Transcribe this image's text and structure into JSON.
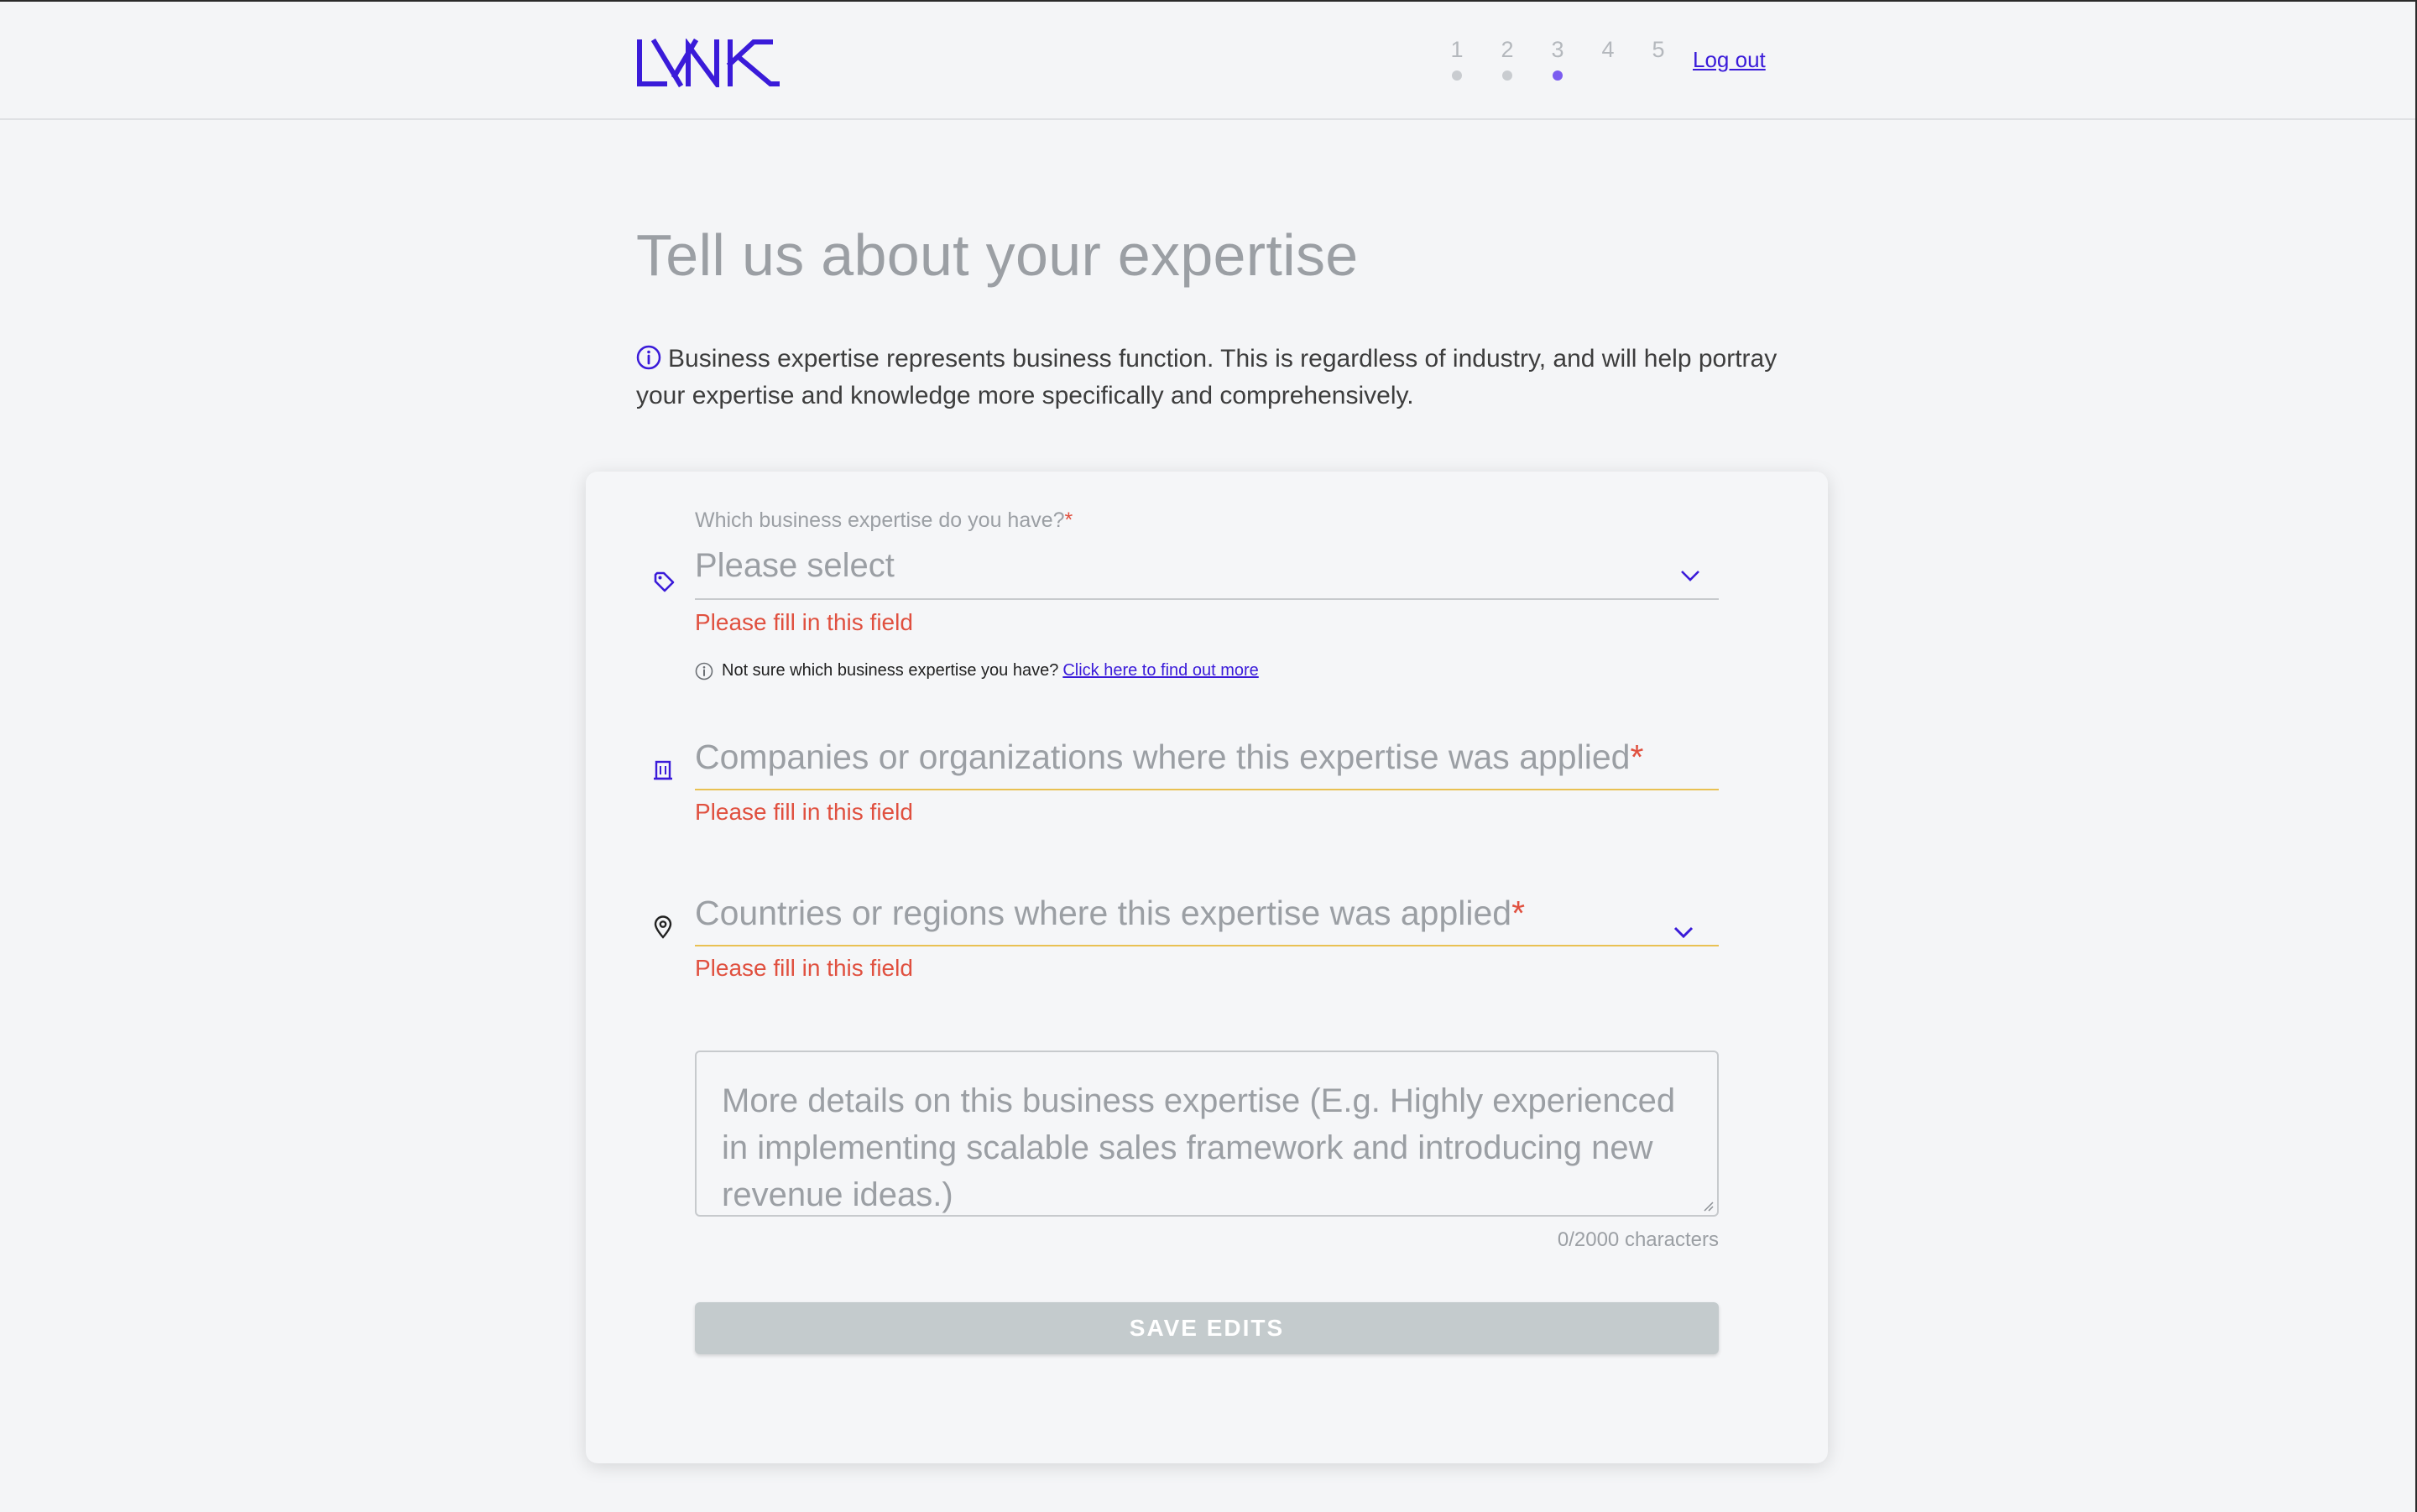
{
  "header": {
    "logo_text": "LYNK",
    "steps": [
      {
        "label": "1",
        "state": "done"
      },
      {
        "label": "2",
        "state": "done"
      },
      {
        "label": "3",
        "state": "current"
      },
      {
        "label": "4",
        "state": "upcoming"
      },
      {
        "label": "5",
        "state": "upcoming"
      }
    ],
    "logout_label": "Log out"
  },
  "page": {
    "title": "Tell us about your expertise",
    "intro_text": "Business expertise represents business function. This is regardless of industry, and will help portray your expertise and knowledge more specifically and comprehensively."
  },
  "form": {
    "business_expertise": {
      "label": "Which business expertise do you have?",
      "required_mark": "*",
      "value": "Please select",
      "error": "Please fill in this field",
      "hint_text": "Not sure which business expertise you have?",
      "hint_link": "Click here to find out more",
      "icon": "tag-icon"
    },
    "companies": {
      "placeholder": "Companies or organizations where this expertise was applied",
      "required_mark": "*",
      "error": "Please fill in this field",
      "icon": "building-icon"
    },
    "countries": {
      "placeholder": "Countries or regions where this expertise was applied",
      "required_mark": "*",
      "error": "Please fill in this field",
      "icon": "location-pin-icon"
    },
    "details": {
      "placeholder": "More details on this business expertise (E.g. Highly experienced in implementing scalable sales framework and introducing new revenue ideas.)",
      "char_count": "0/2000 characters"
    },
    "save_label": "SAVE EDITS"
  },
  "colors": {
    "accent": "#3a1bd9",
    "step_active": "#7b5cf0",
    "error": "#e0503f",
    "warning_underline": "#e9c153",
    "disabled_button": "#c4cbcd"
  }
}
